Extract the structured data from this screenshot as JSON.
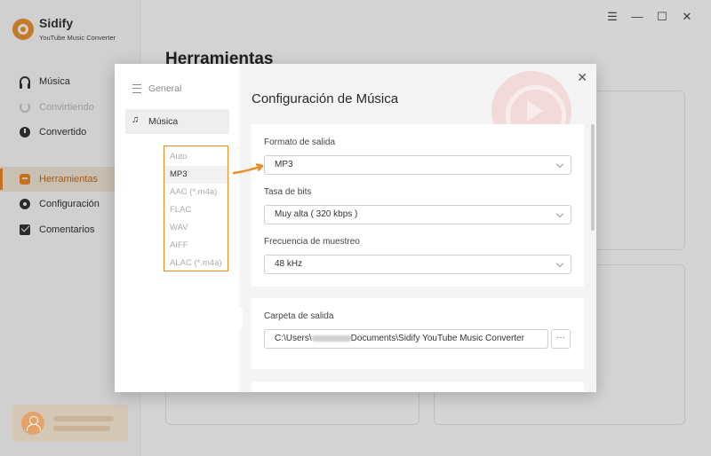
{
  "app": {
    "name": "Sidify",
    "subtitle": "YouTube Music Converter",
    "page_title": "Herramientas",
    "accent": "#f08a24",
    "window_controls": {
      "menu": "☰",
      "minimize": "—",
      "maximize": "☐",
      "close": "✕"
    }
  },
  "sidebar": {
    "items": [
      {
        "label": "Música",
        "icon": "headphones-icon"
      },
      {
        "label": "Convirtiendo",
        "icon": "converting-icon"
      },
      {
        "label": "Convertido",
        "icon": "clock-icon"
      },
      {
        "label": "Herramientas",
        "icon": "toolbox-icon"
      },
      {
        "label": "Configuración",
        "icon": "gear-icon"
      },
      {
        "label": "Comentarios",
        "icon": "mail-icon"
      }
    ],
    "active": "Herramientas"
  },
  "dialog": {
    "title": "Configuración de Música",
    "close": "✕",
    "nav": [
      {
        "label": "General",
        "icon": "sliders-icon"
      },
      {
        "label": "Música",
        "icon": "music-note-icon"
      }
    ],
    "format_options": [
      "Auto",
      "MP3",
      "AAC (*.m4a)",
      "FLAC",
      "WAV",
      "AIFF",
      "ALAC (*.m4a)"
    ],
    "format_selected": "MP3",
    "output_format": {
      "label": "Formato de salida",
      "value": "MP3"
    },
    "bitrate": {
      "label": "Tasa de bits",
      "value": "Muy alta ( 320 kbps )"
    },
    "sample_rate": {
      "label": "Frecuencia de muestreo",
      "value": "48 kHz"
    },
    "output_folder": {
      "label": "Carpeta de salida",
      "path_prefix": "C:\\Users\\",
      "path_suffix": "Documents\\Sidify YouTube Music Converter",
      "browse": "···"
    }
  }
}
